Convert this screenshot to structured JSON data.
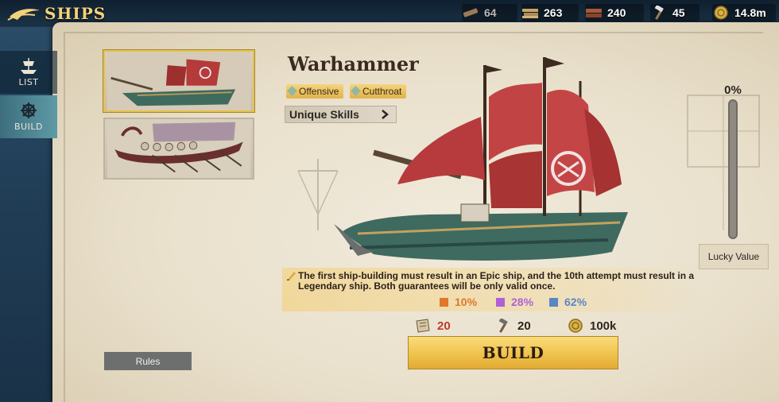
{
  "header": {
    "title": "SHIPS"
  },
  "resources": [
    {
      "icon": "plank-icon",
      "value": "64",
      "dim": true
    },
    {
      "icon": "timber-icon",
      "value": "263",
      "dim": false
    },
    {
      "icon": "lumber-icon",
      "value": "240",
      "dim": false
    },
    {
      "icon": "hammer-icon",
      "value": "45",
      "dim": false
    },
    {
      "icon": "gold-coin-icon",
      "value": "14.8m",
      "dim": false
    }
  ],
  "nav": {
    "list_label": "LIST",
    "build_label": "BUILD"
  },
  "rules_label": "Rules",
  "ship": {
    "name": "Warhammer",
    "tags": [
      "Offensive",
      "Cutthroat"
    ],
    "skills_label": "Unique Skills"
  },
  "lucky": {
    "percent": "0%",
    "fill": 0,
    "label": "Lucky Value"
  },
  "note": "The first ship-building must result in an Epic ship, and the 10th attempt must result in a Legendary ship. Both guarantees will be only valid once.",
  "odds": [
    {
      "value": "10%",
      "color": "#e0772a"
    },
    {
      "value": "28%",
      "color": "#b061d6"
    },
    {
      "value": "62%",
      "color": "#5b86c6"
    }
  ],
  "costs": [
    {
      "icon": "blueprint-icon",
      "value": "20",
      "color": "#c0392b"
    },
    {
      "icon": "hammer-icon",
      "value": "20",
      "color": "#2c2620"
    },
    {
      "icon": "gold-coin-icon",
      "value": "100k",
      "color": "#2c2620"
    }
  ],
  "build_label": "BUILD"
}
